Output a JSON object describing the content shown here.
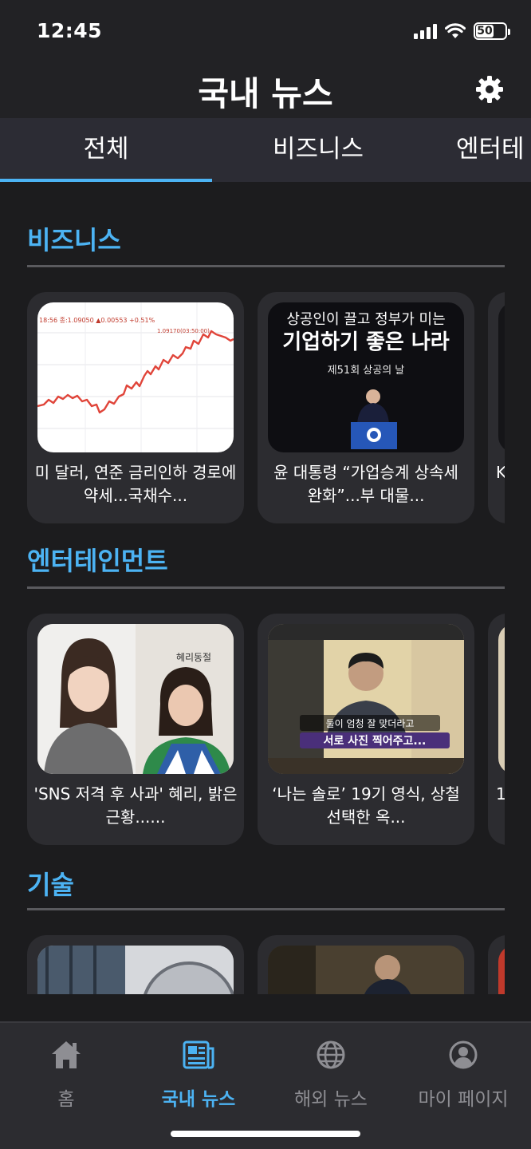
{
  "status_bar": {
    "time": "12:45",
    "battery": "50"
  },
  "header": {
    "title": "국내 뉴스"
  },
  "tabs": [
    {
      "label": "전체"
    },
    {
      "label": "비즈니스"
    },
    {
      "label": "엔터테"
    }
  ],
  "sections": [
    {
      "title": "비즈니스",
      "cards": [
        {
          "headline": "미 달러, 연준 금리인하 경로에 약세...국채수..."
        },
        {
          "headline": "윤 대통령 “가업승계 상속세 완화”...부 대물...",
          "thumb_line1": "상공인이 끌고 정부가 미는",
          "thumb_line2": "기업하기 좋은 나라",
          "thumb_line3": "제51회 상공의 날"
        },
        {
          "headline": "K"
        }
      ]
    },
    {
      "title": "엔터테인먼트",
      "cards": [
        {
          "headline": "'SNS 저격 후 사과' 혜리, 밝은 근황......",
          "thumb_caption": "혜리동절"
        },
        {
          "headline": "‘나는 솔로’ 19기 영식, 상철 선택한 옥...",
          "thumb_caption1": "둘이 엄청 잘 맞더라고",
          "thumb_caption2": "서로 사진 찍어주고..."
        },
        {
          "headline": "1"
        }
      ]
    },
    {
      "title": "기술",
      "cards": [
        {},
        {},
        {}
      ]
    }
  ],
  "chart_thumb": {
    "ticker_text": "18:56 종:1.09050 ▲0.00553 +0.51%",
    "high_text": "1.09170(03:50:00)"
  },
  "bottom_nav": [
    {
      "label": "홈",
      "icon": "home-icon"
    },
    {
      "label": "국내 뉴스",
      "icon": "newspaper-icon"
    },
    {
      "label": "해외 뉴스",
      "icon": "globe-icon"
    },
    {
      "label": "마이 페이지",
      "icon": "user-circle-icon"
    }
  ],
  "colors": {
    "accent": "#4cb3f3",
    "background": "#1c1c1e",
    "card": "#2c2c30",
    "tab_bar": "#2c2c34"
  }
}
